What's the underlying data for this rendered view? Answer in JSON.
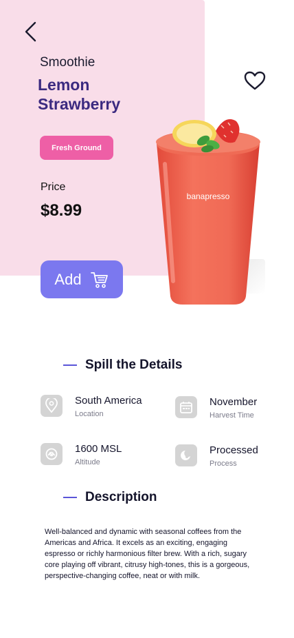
{
  "header": {
    "back_icon": "chevron-left-icon",
    "favorite_icon": "heart-outline-icon"
  },
  "product": {
    "category": "Smoothie",
    "name": "Lemon Strawberry",
    "tag": "Fresh Ground",
    "price_label": "Price",
    "price": "$8.99",
    "add_label": "Add",
    "cup_brand": "banapresso",
    "accent_color": "#7b78ef",
    "tag_color": "#ee5fa6",
    "hero_bg_color": "#f9dde9"
  },
  "details": {
    "heading": "Spill the Details",
    "items": [
      {
        "value": "South America",
        "label": "Location",
        "icon": "location-pin-icon"
      },
      {
        "value": "November",
        "label": "Harvest Time",
        "icon": "calendar-icon"
      },
      {
        "value": "1600 MSL",
        "label": "Altitude",
        "icon": "altitude-icon"
      },
      {
        "value": "Processed",
        "label": "Process",
        "icon": "process-icon"
      }
    ]
  },
  "description": {
    "heading": "Description",
    "text": "Well-balanced and dynamic with seasonal coffees from the Americas and Africa. It excels as an exciting, engaging espresso or richly harmonious filter brew. With a rich, sugary core playing off vibrant, citrusy high-tones, this is a gorgeous, perspective-changing coffee, neat or with milk."
  }
}
